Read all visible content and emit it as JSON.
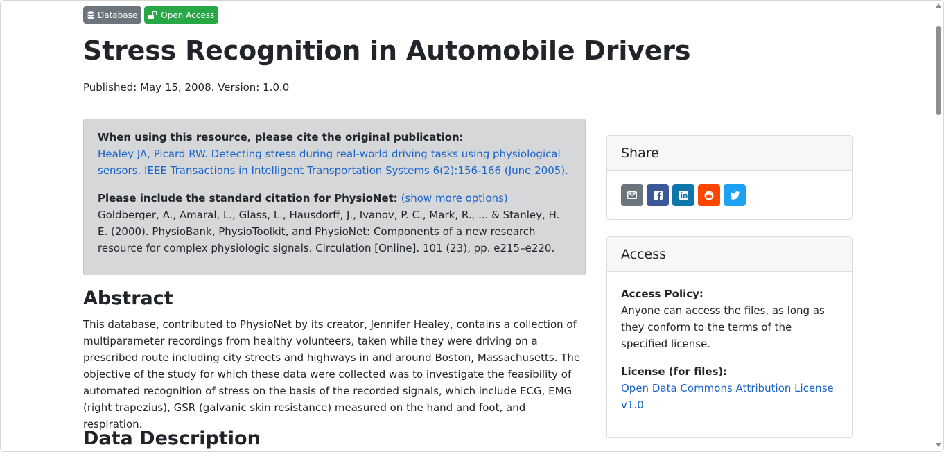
{
  "badges": {
    "database": "Database",
    "open_access": "Open Access"
  },
  "title": "Stress Recognition in Automobile Drivers",
  "published": "Published: May 15, 2008. Version: 1.0.0",
  "citation": {
    "original_heading": "When using this resource, please cite the original publication:",
    "original_link": "Healey JA, Picard RW. Detecting stress during real-world driving tasks using physiological sensors. IEEE Transactions in Intelligent Transportation Systems 6(2):156-166 (June 2005).",
    "standard_heading": "Please include the standard citation for PhysioNet:",
    "show_more": "(show more options)",
    "standard_text": "Goldberger, A., Amaral, L., Glass, L., Hausdorff, J., Ivanov, P. C., Mark, R., ... & Stanley, H. E. (2000). PhysioBank, PhysioToolkit, and PhysioNet: Components of a new research resource for complex physiologic signals. Circulation [Online]. 101 (23), pp. e215–e220."
  },
  "abstract": {
    "heading": "Abstract",
    "text": "This database, contributed to PhysioNet by its creator, Jennifer Healey, contains a collection of multiparameter recordings from healthy volunteers, taken while they were driving on a prescribed route including city streets and highways in and around Boston, Massachusetts. The objective of the study for which these data were collected was to investigate the feasibility of automated recognition of stress on the basis of the recorded signals, which include ECG, EMG (right trapezius), GSR (galvanic skin resistance) measured on the hand and foot, and respiration."
  },
  "data_description": {
    "heading": "Data Description"
  },
  "share": {
    "heading": "Share",
    "icons": [
      "envelope-icon",
      "facebook-icon",
      "linkedin-icon",
      "reddit-icon",
      "twitter-icon"
    ]
  },
  "access": {
    "heading": "Access",
    "policy_label": "Access Policy:",
    "policy_text": "Anyone can access the files, as long as they conform to the terms of the specified license.",
    "license_label": "License (for files):",
    "license_link": "Open Data Commons Attribution License v1.0"
  },
  "colors": {
    "link": "#1a63c9",
    "badge_database": "#6c757d",
    "badge_open_access": "#28a745",
    "citation_box": "#d6d7d9"
  }
}
